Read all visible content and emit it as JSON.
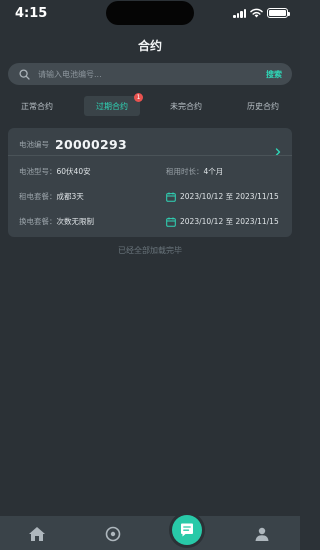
{
  "status_bar": {
    "time": "4:15"
  },
  "header": {
    "title": "合约"
  },
  "search": {
    "placeholder": "请输入电池编号...",
    "button_label": "搜索"
  },
  "tabs": [
    {
      "label": "正常合约",
      "active": false
    },
    {
      "label": "过期合约",
      "active": true,
      "badge": "1"
    },
    {
      "label": "未完合约",
      "active": false
    },
    {
      "label": "历史合约",
      "active": false
    }
  ],
  "contract": {
    "battery_no_label": "电池编号",
    "battery_no": "20000293",
    "battery_model_label": "电池型号",
    "battery_model": "60伏40安",
    "rent_duration_label": "租用时长",
    "rent_duration": "4个月",
    "rent_plan_label": "租电套餐",
    "rent_plan": "成都3天",
    "rent_period": "2023/10/12 至 2023/11/15",
    "swap_plan_label": "换电套餐",
    "swap_plan": "次数无限制",
    "swap_period": "2023/10/12 至 2023/11/15"
  },
  "list_end_text": "已经全部加载完毕",
  "bottom_nav": [
    "home-icon",
    "location-icon",
    "contract-icon",
    "profile-icon"
  ],
  "colors": {
    "accent": "#2fd6b7",
    "background": "#2b3136",
    "card": "#3a4248",
    "badge": "#e8524f"
  }
}
